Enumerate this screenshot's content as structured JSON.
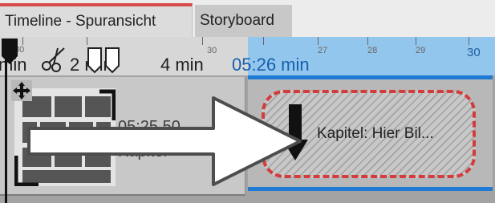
{
  "tabs": [
    {
      "label": "Timeline - Spuransicht",
      "active": true
    },
    {
      "label": "Storyboard",
      "active": false
    }
  ],
  "ruler": {
    "labels": [
      "min",
      "2 min",
      "4 min",
      "05:26 min"
    ],
    "tick_numbers": [
      "30",
      "30",
      "27",
      "28",
      "29",
      "30"
    ]
  },
  "clip": {
    "time": "05:25.50",
    "title": "Kapitel"
  },
  "chapter_marker": {
    "label": "Kapitel: Hier Bil..."
  },
  "colors": {
    "accent_red": "#d84a4a",
    "selection_blue": "#1f7ad3",
    "ruler_blue": "#93c6ec"
  },
  "icons": [
    "scissors-icon",
    "marker-left-icon",
    "marker-right-icon",
    "move-icon",
    "drop-arrow-icon",
    "drag-arrow-icon"
  ]
}
